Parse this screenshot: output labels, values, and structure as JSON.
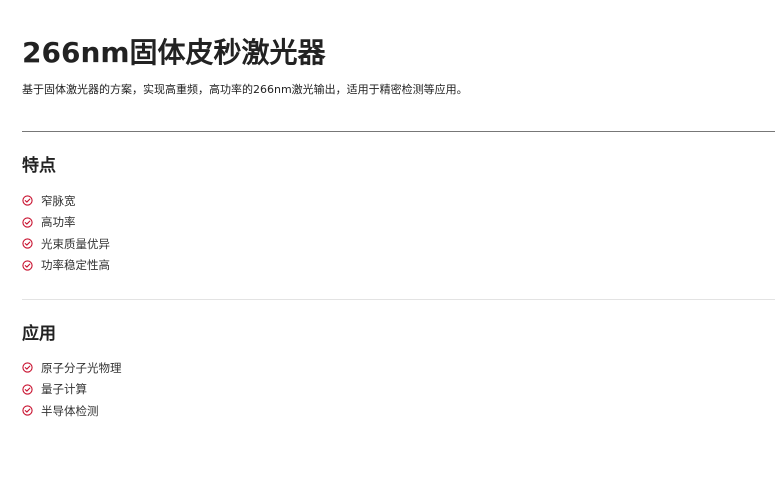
{
  "product": {
    "title": "266nm固体皮秒激光器",
    "description": "基于固体激光器的方案，实现高重频，高功率的266nm激光输出，适用于精密检测等应用。"
  },
  "features": {
    "heading": "特点",
    "items": [
      {
        "label": "窄脉宽",
        "icon": "check-circle-icon"
      },
      {
        "label": "高功率",
        "icon": "check-circle-icon"
      },
      {
        "label": "光束质量优异",
        "icon": "check-circle-icon"
      },
      {
        "label": "功率稳定性高",
        "icon": "check-circle-icon"
      }
    ]
  },
  "applications": {
    "heading": "应用",
    "items": [
      {
        "label": "原子分子光物理",
        "icon": "check-circle-icon"
      },
      {
        "label": "量子计算",
        "icon": "check-circle-icon"
      },
      {
        "label": "半导体检测",
        "icon": "check-circle-icon"
      }
    ]
  },
  "colors": {
    "accent": "#c8102e",
    "text": "#222222",
    "divider_strong": "#777777",
    "divider_light": "#e3e3e3"
  }
}
